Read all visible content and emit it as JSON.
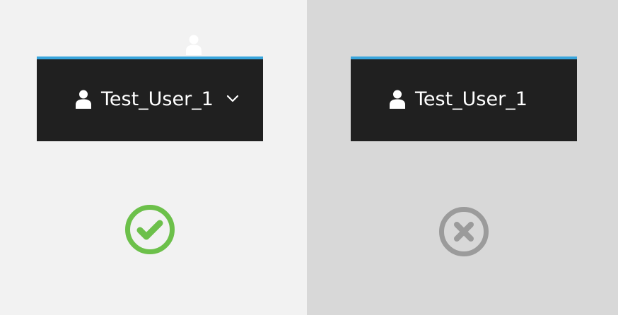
{
  "examples": [
    {
      "verdict": "correct",
      "user_menu": {
        "username": "Test_User_1",
        "has_dropdown": true
      },
      "status_icon": "check-circle-icon",
      "accent": "#6cc04a"
    },
    {
      "verdict": "incorrect",
      "user_menu": {
        "username": "Test_User_1",
        "has_dropdown": false
      },
      "status_icon": "x-circle-icon",
      "accent": "#9b9b9b"
    }
  ],
  "colors": {
    "masthead": "#202020",
    "masthead_top_border": "#39a5dc",
    "good_background": "#f2f2f2",
    "bad_background": "#d8d8d8"
  }
}
